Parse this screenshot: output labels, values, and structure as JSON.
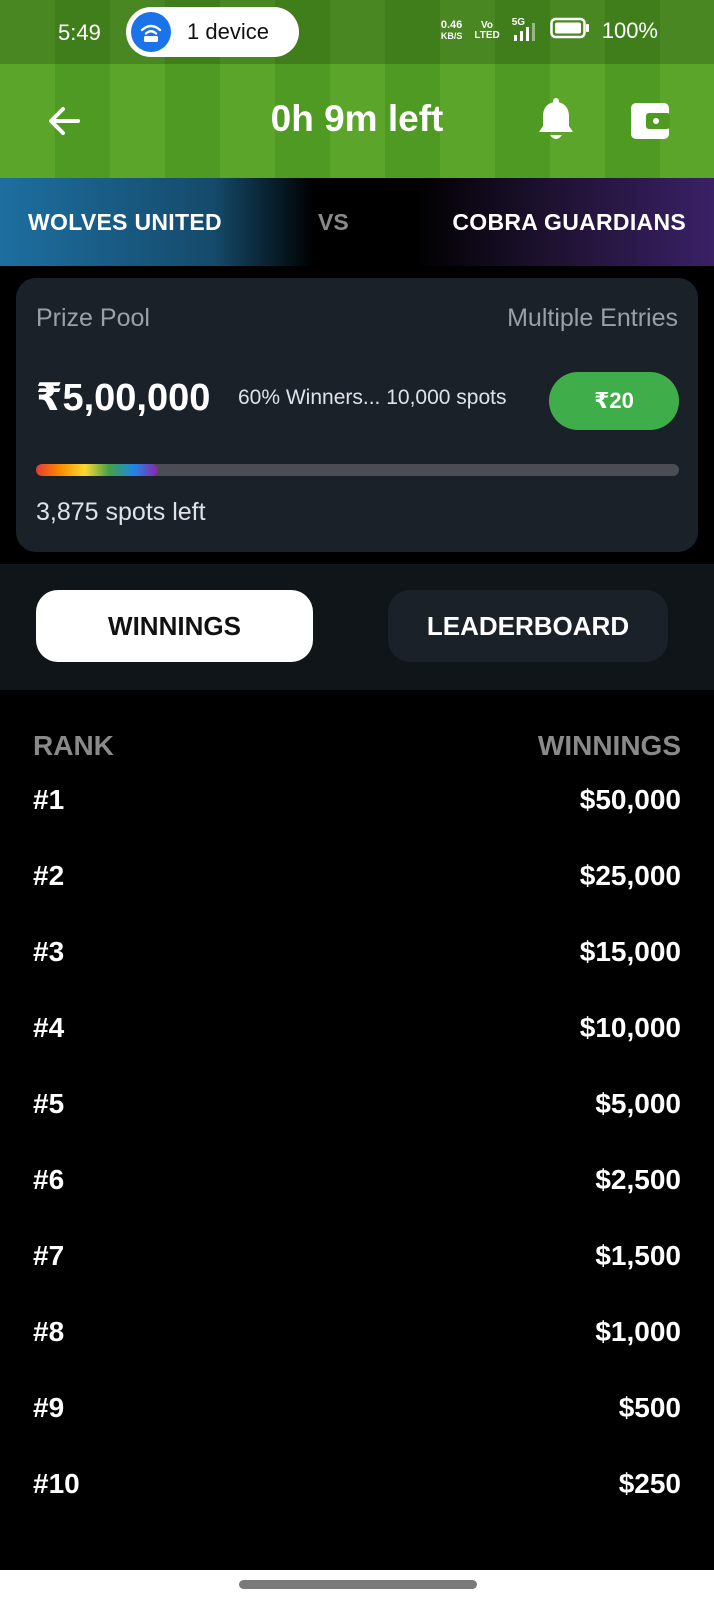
{
  "status_bar": {
    "time": "5:49",
    "hotspot_label": "1 device",
    "speed_value": "0.46",
    "speed_unit": "KB/S",
    "volte_top": "Vo",
    "volte_bottom": "LTED",
    "network": "5G",
    "battery": "100%"
  },
  "header": {
    "title": "0h 9m left"
  },
  "match": {
    "team_left": "WOLVES UNITED",
    "vs": "VS",
    "team_right": "COBRA GUARDIANS"
  },
  "contest": {
    "prize_pool_label": "Prize Pool",
    "entries_label": "Multiple Entries",
    "prize_amount": "₹5,00,000",
    "winners_info": "60% Winners... 10,000 spots",
    "entry_fee": "₹20",
    "progress_fraction": 0.19,
    "spots_left": "3,875 spots left"
  },
  "tabs": {
    "winnings": "WINNINGS",
    "leaderboard": "LEADERBOARD"
  },
  "table": {
    "rank_header": "RANK",
    "winnings_header": "WINNINGS",
    "rows": [
      {
        "rank": "#1",
        "amount": "$50,000"
      },
      {
        "rank": "#2",
        "amount": "$25,000"
      },
      {
        "rank": "#3",
        "amount": "$15,000"
      },
      {
        "rank": "#4",
        "amount": "$10,000"
      },
      {
        "rank": "#5",
        "amount": "$5,000"
      },
      {
        "rank": "#6",
        "amount": "$2,500"
      },
      {
        "rank": "#7",
        "amount": "$1,500"
      },
      {
        "rank": "#8",
        "amount": "$1,000"
      },
      {
        "rank": "#9",
        "amount": "$500"
      },
      {
        "rank": "#10",
        "amount": "$250"
      }
    ]
  },
  "colors": {
    "pitch_green": "#5aa52a",
    "fee_green": "#3fae4a",
    "card_bg": "#1b2128"
  }
}
